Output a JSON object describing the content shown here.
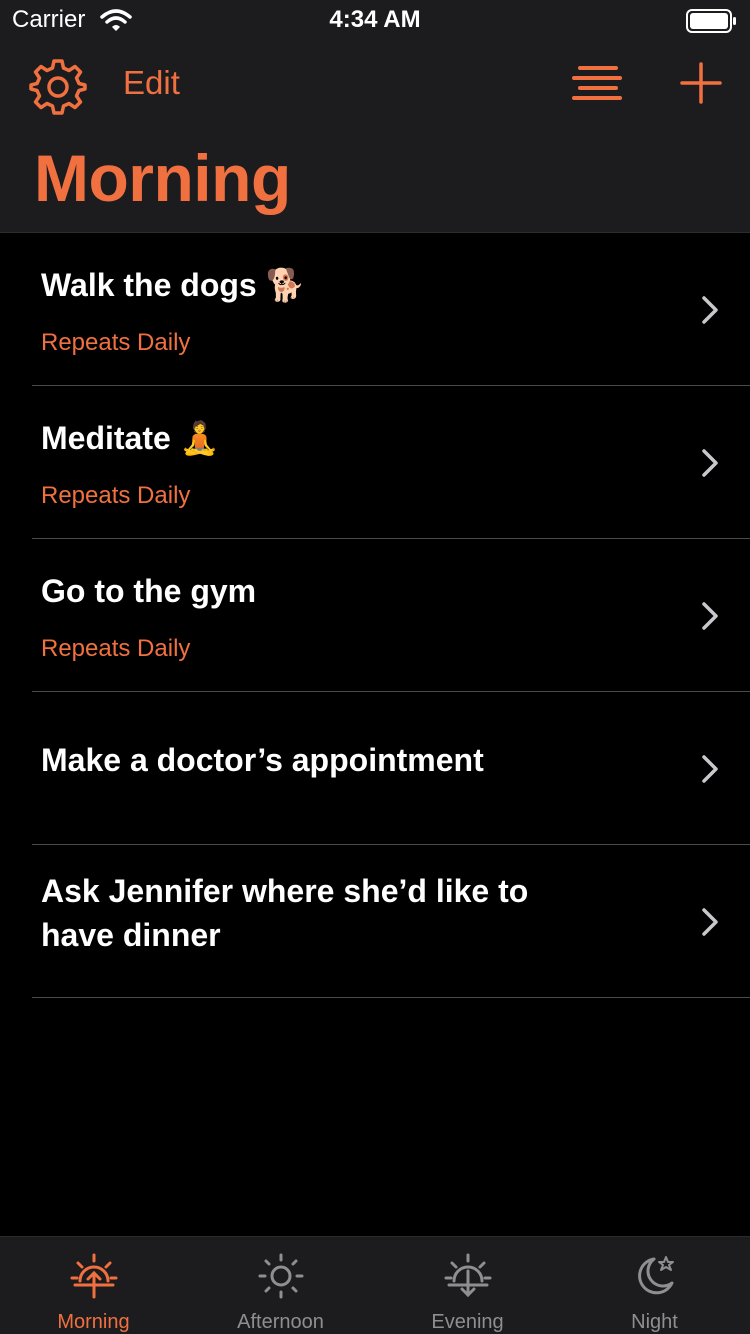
{
  "status": {
    "carrier": "Carrier",
    "time": "4:34 AM"
  },
  "header": {
    "edit_label": "Edit",
    "title": "Morning"
  },
  "items": [
    {
      "title": "Walk the dogs 🐕",
      "subtitle": "Repeats Daily"
    },
    {
      "title": "Meditate 🧘",
      "subtitle": "Repeats Daily"
    },
    {
      "title": "Go to the gym",
      "subtitle": "Repeats Daily"
    },
    {
      "title": "Make a doctor’s appointment",
      "subtitle": ""
    },
    {
      "title": "Ask Jennifer where she’d like to have dinner",
      "subtitle": ""
    }
  ],
  "tabs": [
    {
      "label": "Morning",
      "icon": "sunrise-icon",
      "active": true
    },
    {
      "label": "Afternoon",
      "icon": "sun-icon",
      "active": false
    },
    {
      "label": "Evening",
      "icon": "sunset-icon",
      "active": false
    },
    {
      "label": "Night",
      "icon": "moon-star-icon",
      "active": false
    }
  ],
  "colors": {
    "accent": "#f07040",
    "background": "#000000",
    "bar": "#1c1c1e",
    "separator": "#4a4a4e",
    "inactive": "#8e8e93"
  }
}
